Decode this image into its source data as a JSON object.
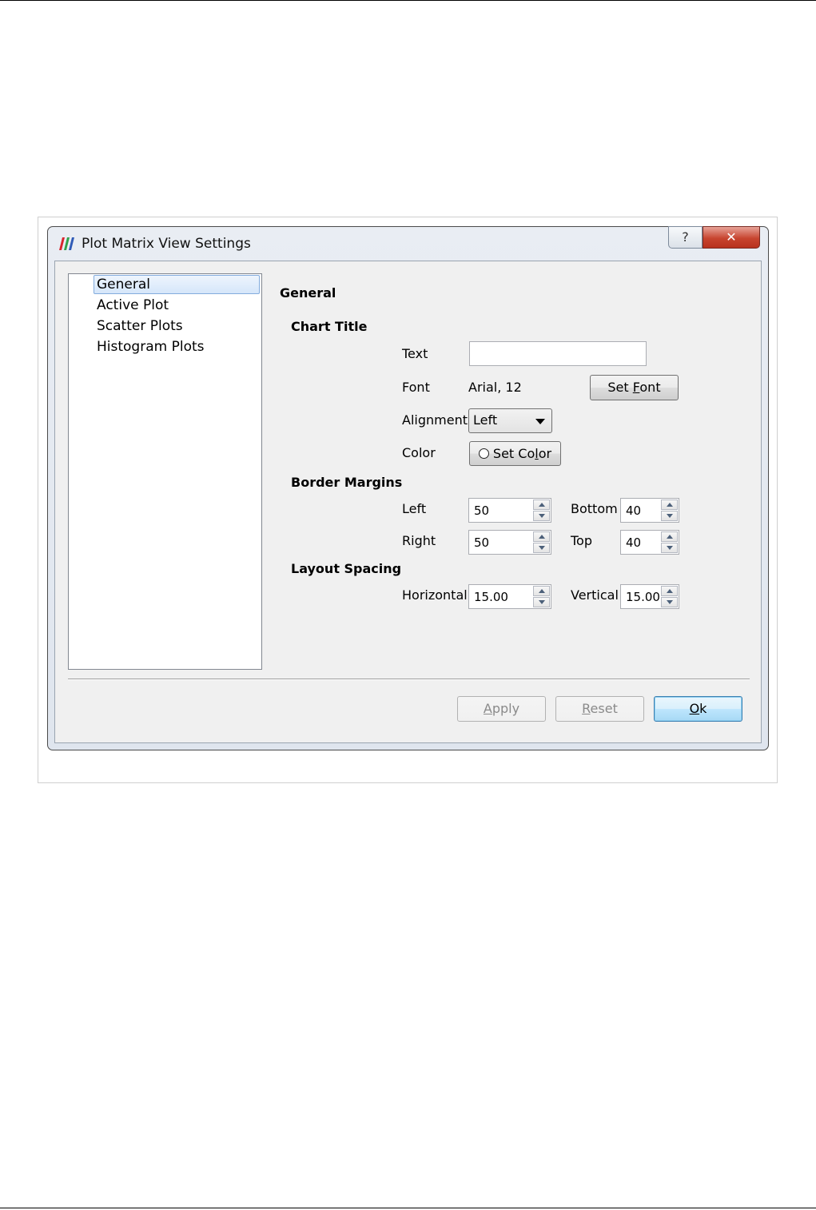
{
  "dialog": {
    "title": "Plot Matrix View Settings",
    "help_label": "?",
    "close_label": "✕"
  },
  "sidebar": {
    "items": [
      {
        "label": "General",
        "selected": true
      },
      {
        "label": "Active Plot"
      },
      {
        "label": "Scatter Plots"
      },
      {
        "label": "Histogram Plots"
      }
    ]
  },
  "main": {
    "section_title": "General",
    "chart_title": {
      "heading": "Chart Title",
      "text_label": "Text",
      "text_value": "",
      "font_label": "Font",
      "font_value": "Arial, 12",
      "set_font_pre": "Set ",
      "set_font_mnemonic": "F",
      "set_font_post": "ont",
      "alignment_label": "Alignment",
      "alignment_value": "Left",
      "color_label": "Color",
      "set_color_pre": "Set Co",
      "set_color_mnemonic": "l",
      "set_color_post": "or"
    },
    "border_margins": {
      "heading": "Border Margins",
      "left_label": "Left",
      "left_value": "50",
      "right_label": "Right",
      "right_value": "50",
      "bottom_label": "Bottom",
      "bottom_value": "40",
      "top_label": "Top",
      "top_value": "40"
    },
    "layout_spacing": {
      "heading": "Layout Spacing",
      "horizontal_label": "Horizontal",
      "horizontal_value": "15.00",
      "vertical_label": "Vertical",
      "vertical_value": "15.00"
    }
  },
  "footer": {
    "apply_mnemonic": "A",
    "apply_rest": "pply",
    "reset_mnemonic": "R",
    "reset_rest": "eset",
    "ok_mnemonic": "O",
    "ok_rest": "k"
  },
  "colors": {
    "accent_selection": "#84acdd",
    "close_button": "#c7442f"
  }
}
